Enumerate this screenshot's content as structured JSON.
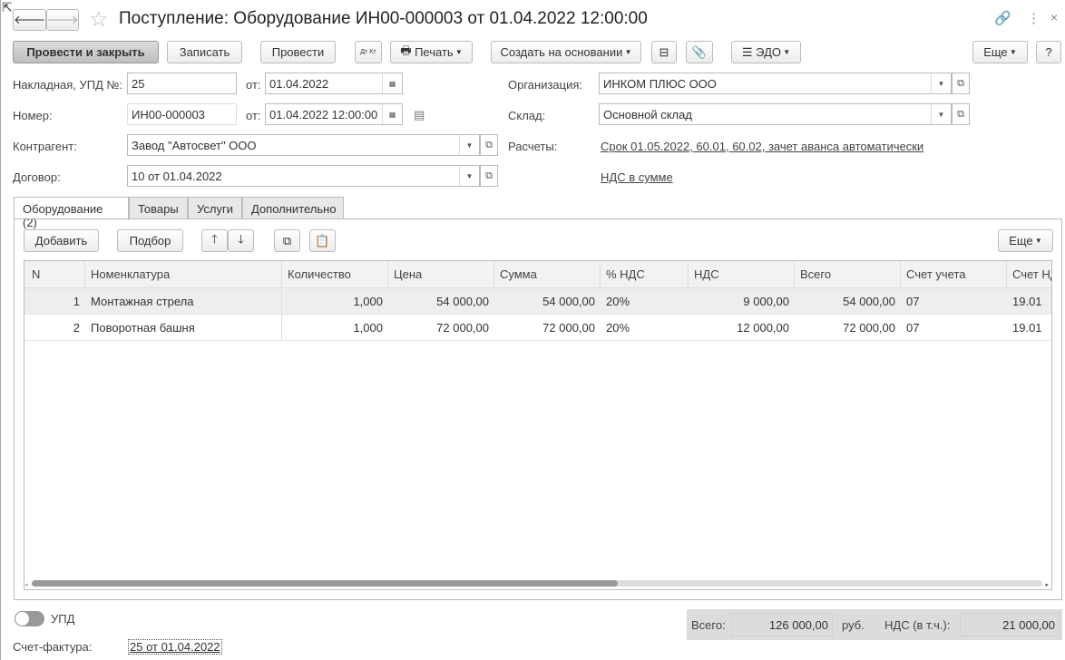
{
  "title": "Поступление: Оборудование ИН00-000003 от 01.04.2022 12:00:00",
  "toolbar": {
    "post_close": "Провести и закрыть",
    "save": "Записать",
    "post": "Провести",
    "dtkt": "Дт Кт",
    "print": "Печать",
    "create_based": "Создать на основании",
    "edo": "ЭДО",
    "more": "Еще",
    "help": "?"
  },
  "form": {
    "invoice_label": "Накладная, УПД №:",
    "invoice_no": "25",
    "from1": "от:",
    "invoice_date": "01.04.2022",
    "number_label": "Номер:",
    "number": "ИН00-000003",
    "from2": "от:",
    "number_date": "01.04.2022 12:00:00",
    "counterparty_label": "Контрагент:",
    "counterparty": "Завод \"Автосвет\" ООО",
    "contract_label": "Договор:",
    "contract": "10 от 01.04.2022",
    "org_label": "Организация:",
    "org": "ИНКОМ ПЛЮС ООО",
    "warehouse_label": "Склад:",
    "warehouse": "Основной склад",
    "settlements_label": "Расчеты:",
    "settlements": "Срок 01.05.2022, 60.01, 60.02, зачет аванса автоматически",
    "vat_link": "НДС в сумме"
  },
  "tabs": [
    "Оборудование (2)",
    "Товары",
    "Услуги",
    "Дополнительно"
  ],
  "table_toolbar": {
    "add": "Добавить",
    "select": "Подбор",
    "more": "Еще"
  },
  "columns": [
    "N",
    "Номенклатура",
    "Количество",
    "Цена",
    "Сумма",
    "% НДС",
    "НДС",
    "Всего",
    "Счет учета",
    "Счет НДС"
  ],
  "rows": [
    [
      "1",
      "Монтажная стрела",
      "1,000",
      "54 000,00",
      "54 000,00",
      "20%",
      "9 000,00",
      "54 000,00",
      "07",
      "19.01"
    ],
    [
      "2",
      "Поворотная башня",
      "1,000",
      "72 000,00",
      "72 000,00",
      "20%",
      "12 000,00",
      "72 000,00",
      "07",
      "19.01"
    ]
  ],
  "scroll_fraction": 0.58,
  "footer": {
    "upd": "УПД",
    "invoice_label": "Счет-фактура:",
    "invoice_link": "25 от 01.04.2022",
    "total_label": "Всего:",
    "total": "126 000,00",
    "currency": "руб.",
    "vat_label": "НДС (в т.ч.):",
    "vat": "21 000,00"
  }
}
